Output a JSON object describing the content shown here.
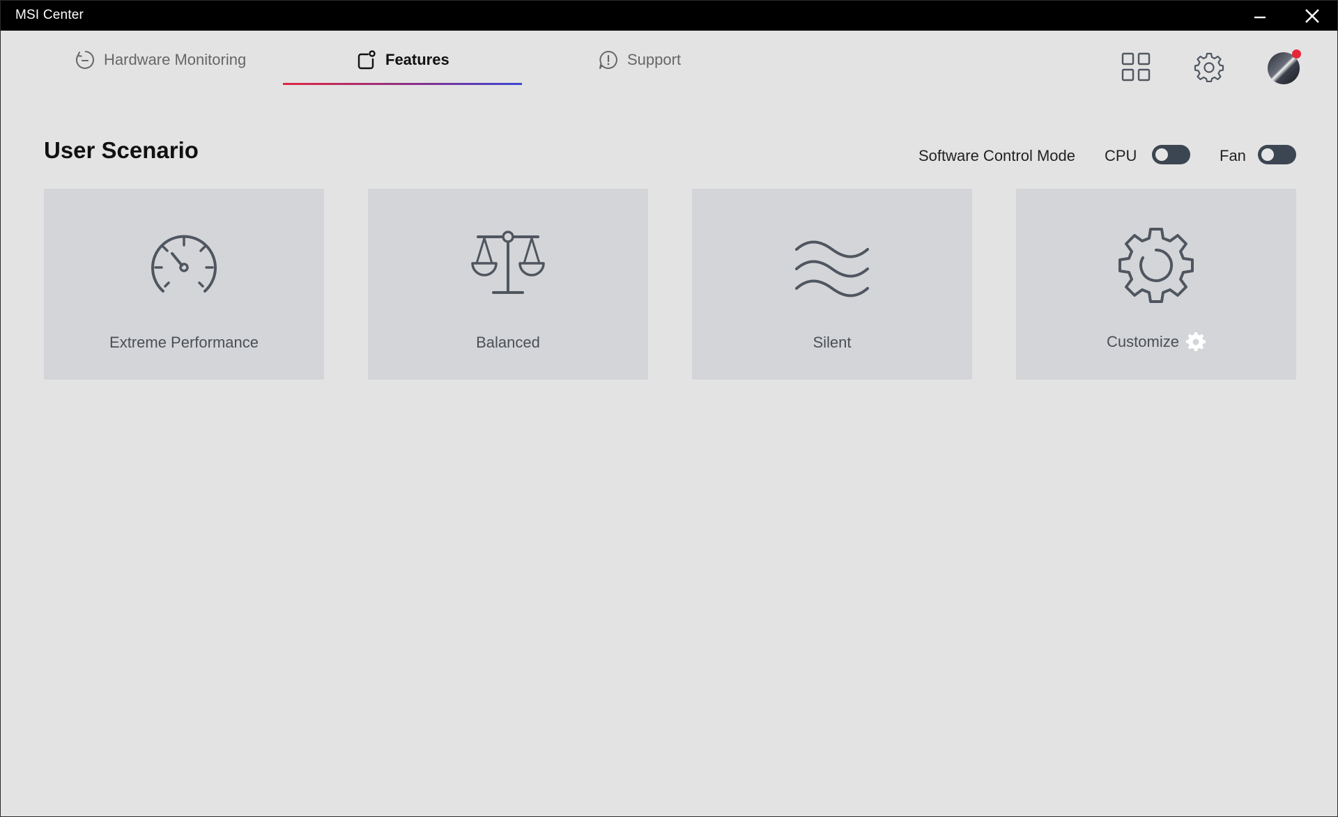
{
  "window": {
    "title": "MSI Center"
  },
  "nav": {
    "tabs": [
      {
        "label": "Hardware Monitoring",
        "icon": "hardware-monitoring-icon",
        "active": false
      },
      {
        "label": "Features",
        "icon": "features-icon",
        "active": true
      },
      {
        "label": "Support",
        "icon": "support-icon",
        "active": false
      }
    ],
    "right_icons": [
      "grid-icon",
      "gear-icon",
      "avatar"
    ]
  },
  "section": {
    "title": "User Scenario",
    "software_control_mode_label": "Software Control Mode",
    "cpu_label": "CPU",
    "fan_label": "Fan",
    "cpu_toggle_on": false,
    "fan_toggle_on": false
  },
  "scenarios": [
    {
      "label": "Extreme Performance",
      "icon": "speedometer-icon"
    },
    {
      "label": "Balanced",
      "icon": "balance-scale-icon"
    },
    {
      "label": "Silent",
      "icon": "waves-icon"
    },
    {
      "label": "Customize",
      "icon": "gear-icon",
      "has_settings_icon": true
    }
  ],
  "colors": {
    "titlebar": "#000000",
    "background": "#e3e3e3",
    "card": "#d4d5d8",
    "toggle_off": "#3c4652",
    "icon_stroke": "#4f5660",
    "underline_start": "#e0263f",
    "underline_end": "#3b46d6",
    "notification_dot": "#e8263a"
  }
}
